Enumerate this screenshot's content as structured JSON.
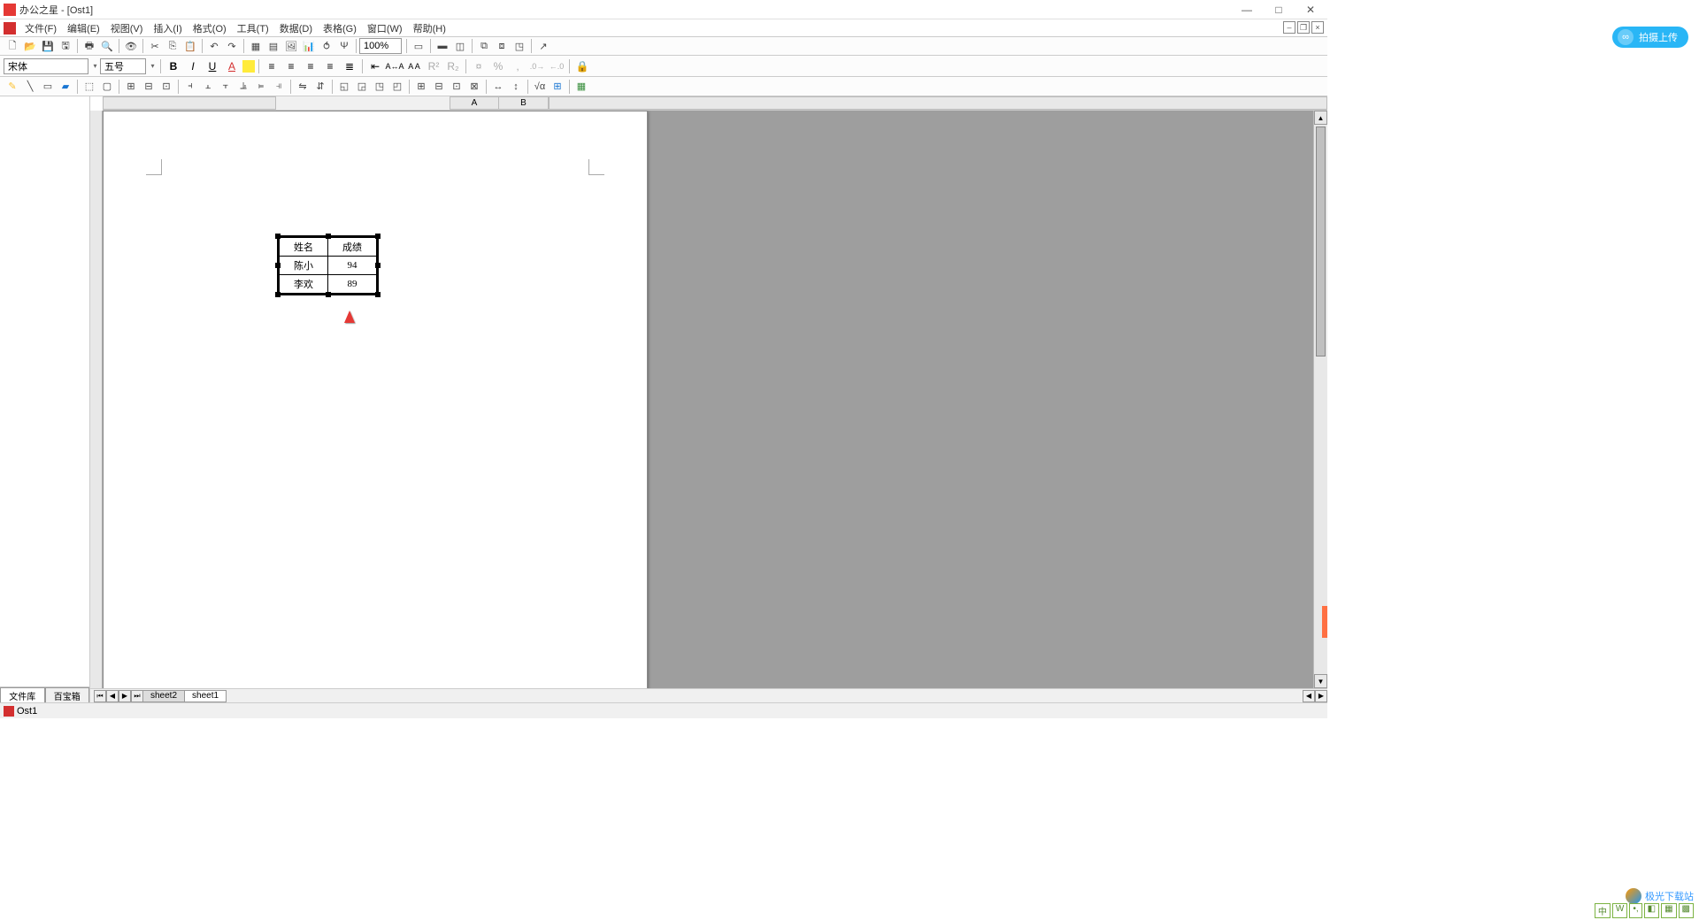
{
  "app": {
    "title": "办公之星 - [Ost1]"
  },
  "menu": {
    "items": [
      "文件(F)",
      "编辑(E)",
      "视图(V)",
      "插入(I)",
      "格式(O)",
      "工具(T)",
      "数据(D)",
      "表格(G)",
      "窗口(W)",
      "帮助(H)"
    ]
  },
  "cloud": {
    "label": "拍摄上传"
  },
  "font": {
    "family": "宋体",
    "size": "五号"
  },
  "zoom": "100%",
  "columns": {
    "a": "A",
    "b": "B"
  },
  "table": {
    "headers": [
      "姓名",
      "成绩"
    ],
    "rows": [
      [
        "陈小",
        "94"
      ],
      [
        "李欢",
        "89"
      ]
    ]
  },
  "sheets": {
    "tabs": [
      "sheet2",
      "sheet1"
    ],
    "active": 1
  },
  "left_panel": {
    "tabs": [
      "文件库",
      "百宝箱"
    ],
    "active": 0
  },
  "doc": {
    "name": "Ost1"
  },
  "watermark": {
    "text": "极光下载站"
  },
  "ime": {
    "items": [
      "中",
      "W",
      "•,",
      "◧",
      "▦",
      "▩"
    ]
  }
}
